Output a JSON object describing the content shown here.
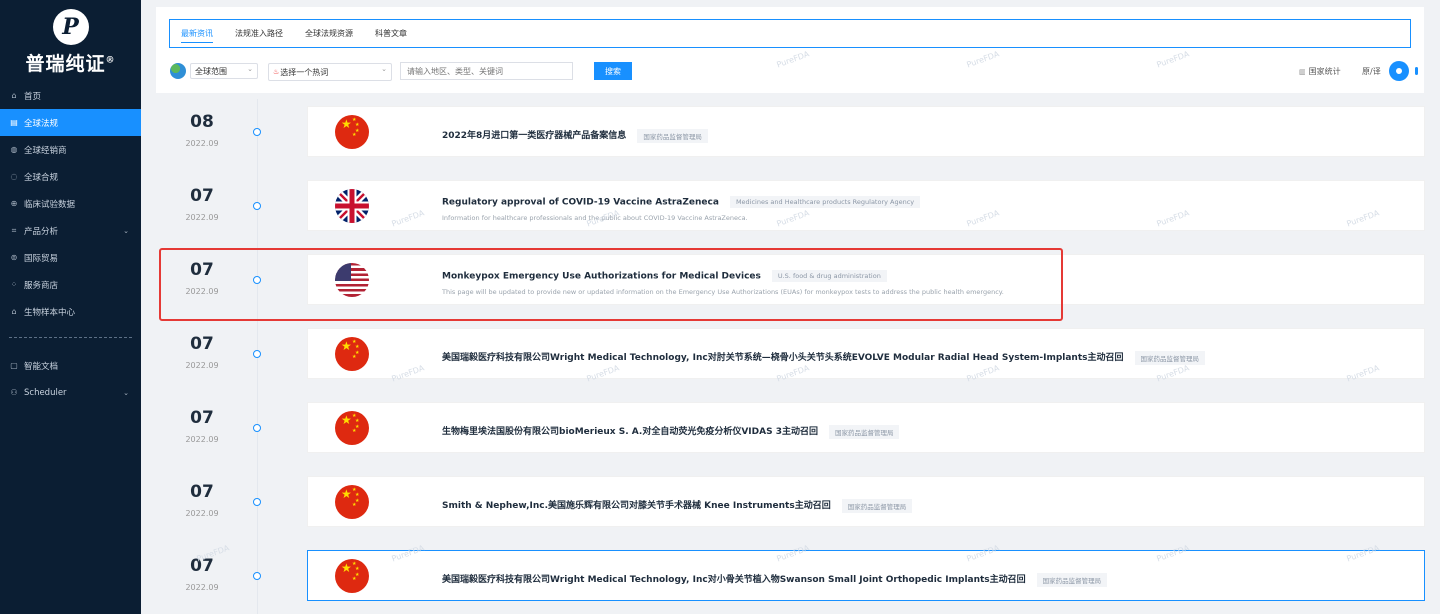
{
  "brand": {
    "logo_letter": "P",
    "name": "普瑞纯证",
    "mark": "®"
  },
  "sidebar": {
    "items": [
      {
        "label": "首页",
        "icon": "home-icon",
        "glyph": "⌂"
      },
      {
        "label": "全球法规",
        "icon": "document-icon",
        "glyph": "▤",
        "active": true
      },
      {
        "label": "全球经销商",
        "icon": "globe-icon",
        "glyph": "◍"
      },
      {
        "label": "全球合规",
        "icon": "shield-icon",
        "glyph": "◌"
      },
      {
        "label": "临床试验数据",
        "icon": "flask-icon",
        "glyph": "⊕"
      },
      {
        "label": "产品分析",
        "icon": "chart-icon",
        "glyph": "⌗",
        "expandable": true
      },
      {
        "label": "国际贸易",
        "icon": "trade-icon",
        "glyph": "⊚"
      },
      {
        "label": "服务商店",
        "icon": "grid-icon",
        "glyph": "⁘"
      },
      {
        "label": "生物样本中心",
        "icon": "bank-icon",
        "glyph": "⌂"
      }
    ],
    "bottom_items": [
      {
        "label": "智能文档",
        "icon": "file-icon",
        "glyph": "▢"
      },
      {
        "label": "Scheduler",
        "icon": "scheduler-icon",
        "glyph": "⚇",
        "expandable": true
      }
    ],
    "expand_glyph": "⌄"
  },
  "tabs": [
    "最新资讯",
    "法规准入路径",
    "全球法规资源",
    "科普文章"
  ],
  "filters": {
    "scope": "全球范围",
    "hot_word": "选择一个热词",
    "search_placeholder": "请输入地区、类型、关键词",
    "search_button": "搜索",
    "stats_link": "国家统计",
    "toggle_label": "原/译"
  },
  "watermark": "PureFDA",
  "entries": [
    {
      "day": "08",
      "month": "2022.09",
      "flag": "cn",
      "title": "2022年8月进口第一类医疗器械产品备案信息",
      "tag": "国家药品监督管理局",
      "desc": ""
    },
    {
      "day": "07",
      "month": "2022.09",
      "flag": "uk",
      "title": "Regulatory approval of COVID-19 Vaccine AstraZeneca",
      "tag": "Medicines and Healthcare products Regulatory Agency",
      "desc": "Information for healthcare professionals and the public about COVID-19 Vaccine AstraZeneca."
    },
    {
      "day": "07",
      "month": "2022.09",
      "flag": "us",
      "title": "Monkeypox Emergency Use Authorizations for Medical Devices",
      "tag": "U.S. food & drug administration",
      "desc": "This page will be updated to provide new or updated information on the Emergency Use Authorizations (EUAs) for monkeypox tests to address the public health emergency."
    },
    {
      "day": "07",
      "month": "2022.09",
      "flag": "cn",
      "title": "美国瑞毅医疗科技有限公司Wright Medical Technology, Inc对肘关节系统—桡骨小头关节头系统EVOLVE Modular Radial Head System-Implants主动召回",
      "tag": "国家药品监督管理局",
      "desc": ""
    },
    {
      "day": "07",
      "month": "2022.09",
      "flag": "cn",
      "title": "生物梅里埃法国股份有限公司bioMerieux S. A.对全自动荧光免疫分析仪VIDAS 3主动召回",
      "tag": "国家药品监督管理局",
      "desc": ""
    },
    {
      "day": "07",
      "month": "2022.09",
      "flag": "cn",
      "title": "Smith & Nephew,Inc.美国施乐辉有限公司对膝关节手术器械 Knee Instruments主动召回",
      "tag": "国家药品监督管理局",
      "desc": ""
    },
    {
      "day": "07",
      "month": "2022.09",
      "flag": "cn",
      "title": "美国瑞毅医疗科技有限公司Wright Medical Technology, Inc对小骨关节植入物Swanson Small Joint Orthopedic Implants主动召回",
      "tag": "国家药品监督管理局",
      "desc": ""
    }
  ]
}
